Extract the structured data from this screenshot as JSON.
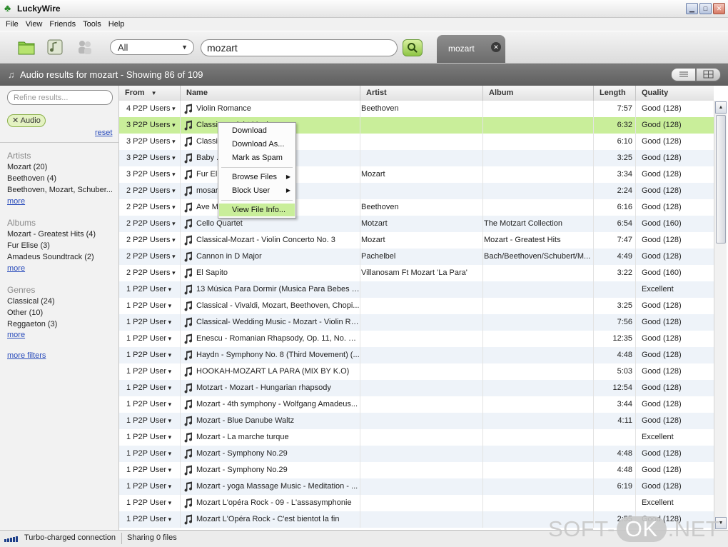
{
  "app": {
    "title": "LuckyWire"
  },
  "menu": [
    "File",
    "View",
    "Friends",
    "Tools",
    "Help"
  ],
  "toolbar": {
    "category_value": "All",
    "search_value": "mozart",
    "tab_label": "mozart"
  },
  "results_header": "Audio results for mozart - Showing 86 of 109",
  "sidebar": {
    "refine_placeholder": "Refine results...",
    "filter_chip": "Audio",
    "reset": "reset",
    "artists": {
      "title": "Artists",
      "items": [
        "Mozart (20)",
        "Beethoven (4)",
        "Beethoven, Mozart, Schuber..."
      ],
      "more": "more"
    },
    "albums": {
      "title": "Albums",
      "items": [
        "Mozart - Greatest Hits (4)",
        "Fur Elise (3)",
        "Amadeus Soundtrack (2)"
      ],
      "more": "more"
    },
    "genres": {
      "title": "Genres",
      "items": [
        "Classical (24)",
        "Other (10)",
        "Reggaeton (3)"
      ],
      "more": "more"
    },
    "more_filters": "more filters"
  },
  "table": {
    "columns": [
      "From",
      "Name",
      "Artist",
      "Album",
      "Length",
      "Quality"
    ],
    "sort_indicator": "▼",
    "rows": [
      {
        "from": "4 P2P Users",
        "name": "Violin Romance",
        "artist": "Beethoven",
        "album": "",
        "length": "7:57",
        "quality": "Good (128)"
      },
      {
        "from": "3 P2P Users",
        "name": "Classic... ...ight Music",
        "artist": "",
        "album": "",
        "length": "6:32",
        "quality": "Good (128)",
        "selected": true
      },
      {
        "from": "3 P2P Users",
        "name": "Classi... Sonata",
        "artist": "",
        "album": "",
        "length": "6:10",
        "quality": "Good (128)"
      },
      {
        "from": "3 P2P Users",
        "name": "Baby ... ...valdi, Mozart, Be...",
        "artist": "",
        "album": "",
        "length": "3:25",
        "quality": "Good (128)"
      },
      {
        "from": "3 P2P Users",
        "name": "Fur Eli...",
        "artist": "Mozart",
        "album": "",
        "length": "3:34",
        "quality": "Good (128)"
      },
      {
        "from": "2 P2P Users",
        "name": "mosar... ...art - 7th sympho...",
        "artist": "",
        "album": "",
        "length": "2:24",
        "quality": "Good (128)"
      },
      {
        "from": "2 P2P Users",
        "name": "Ave M...",
        "artist": "Beethoven",
        "album": "",
        "length": "6:16",
        "quality": "Good (128)"
      },
      {
        "from": "2 P2P Users",
        "name": "Cello Quartet",
        "artist": "Motzart",
        "album": "The Motzart Collection",
        "length": "6:54",
        "quality": "Good (160)"
      },
      {
        "from": "2 P2P Users",
        "name": "Classical-Mozart - Violin Concerto No. 3",
        "artist": "Mozart",
        "album": "Mozart - Greatest Hits",
        "length": "7:47",
        "quality": "Good (128)"
      },
      {
        "from": "2 P2P Users",
        "name": "Cannon in D Major",
        "artist": "Pachelbel",
        "album": "Bach/Beethoven/Schubert/M...",
        "length": "4:49",
        "quality": "Good (128)"
      },
      {
        "from": "2 P2P Users",
        "name": "El Sapito",
        "artist": "Villanosam Ft Mozart 'La Para'",
        "album": "",
        "length": "3:22",
        "quality": "Good (160)"
      },
      {
        "from": "1 P2P User",
        "name": "13 Música Para Dormir (Musica Para Bebes B...",
        "artist": "",
        "album": "",
        "length": "",
        "quality": "Excellent"
      },
      {
        "from": "1 P2P User",
        "name": "Classical - Vivaldi, Mozart, Beethoven, Chopi...",
        "artist": "",
        "album": "",
        "length": "3:25",
        "quality": "Good (128)"
      },
      {
        "from": "1 P2P User",
        "name": "Classical- Wedding Music - Mozart - Violin Ro...",
        "artist": "",
        "album": "",
        "length": "7:56",
        "quality": "Good (128)"
      },
      {
        "from": "1 P2P User",
        "name": "Enescu - Romanian Rhapsody, Op. 11, No. 1-...",
        "artist": "",
        "album": "",
        "length": "12:35",
        "quality": "Good (128)"
      },
      {
        "from": "1 P2P User",
        "name": "Haydn - Symphony No. 8 (Third Movement) (...",
        "artist": "",
        "album": "",
        "length": "4:48",
        "quality": "Good (128)"
      },
      {
        "from": "1 P2P User",
        "name": "HOOKAH-MOZART LA PARA (MIX BY K.O)",
        "artist": "",
        "album": "",
        "length": "5:03",
        "quality": "Good (128)"
      },
      {
        "from": "1 P2P User",
        "name": "Motzart - Mozart - Hungarian rhapsody",
        "artist": "",
        "album": "",
        "length": "12:54",
        "quality": "Good (128)"
      },
      {
        "from": "1 P2P User",
        "name": "Mozart - 4th symphony - Wolfgang Amadeus...",
        "artist": "",
        "album": "",
        "length": "3:44",
        "quality": "Good (128)"
      },
      {
        "from": "1 P2P User",
        "name": "Mozart - Blue Danube Waltz",
        "artist": "",
        "album": "",
        "length": "4:11",
        "quality": "Good (128)"
      },
      {
        "from": "1 P2P User",
        "name": "Mozart - La marche turque",
        "artist": "",
        "album": "",
        "length": "",
        "quality": "Excellent"
      },
      {
        "from": "1 P2P User",
        "name": "Mozart - Symphony No.29",
        "artist": "",
        "album": "",
        "length": "4:48",
        "quality": "Good (128)"
      },
      {
        "from": "1 P2P User",
        "name": "Mozart - Symphony No.29",
        "artist": "",
        "album": "",
        "length": "4:48",
        "quality": "Good (128)"
      },
      {
        "from": "1 P2P User",
        "name": "Mozart - yoga Massage Music - Meditation - ...",
        "artist": "",
        "album": "",
        "length": "6:19",
        "quality": "Good (128)"
      },
      {
        "from": "1 P2P User",
        "name": "Mozart L'opéra Rock - 09 - L'assasymphonie",
        "artist": "",
        "album": "",
        "length": "",
        "quality": "Excellent"
      },
      {
        "from": "1 P2P User",
        "name": "Mozart L'Opéra Rock - C'est bientot la fin",
        "artist": "",
        "album": "",
        "length": "2:55",
        "quality": "Good (128)"
      }
    ]
  },
  "context_menu": {
    "items": [
      "Download",
      "Download As...",
      "Mark as Spam",
      "Browse Files",
      "Block User",
      "View File Info..."
    ],
    "highlighted": "View File Info..."
  },
  "status": {
    "connection": "Turbo-charged connection",
    "sharing": "Sharing 0 files"
  },
  "watermark": {
    "left": "SOFT-",
    "middle": "OK",
    "right": ".NET"
  },
  "colors": {
    "selected_row": "#c9ee9a",
    "header_bar": "#6d6d6d",
    "link": "#2a4cbb"
  }
}
